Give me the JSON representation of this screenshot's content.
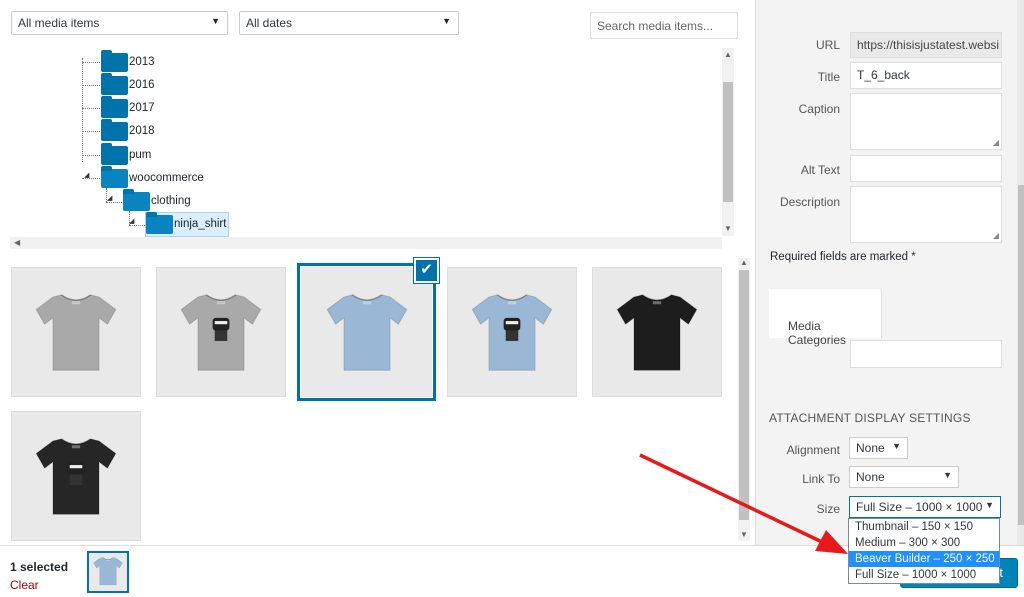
{
  "filters": {
    "media_type": "All media items",
    "dates": "All dates",
    "search_placeholder": "Search media items..."
  },
  "tree": {
    "folders": [
      "2013",
      "2016",
      "2017",
      "2018",
      "pum",
      "woocommerce",
      "clothing",
      "ninja_shirt"
    ]
  },
  "thumbnails": [
    {
      "name": "t-shirt-gray-back",
      "color": "#a9a9a9"
    },
    {
      "name": "t-shirt-gray-ninja",
      "color": "#a9a9a9"
    },
    {
      "name": "t-shirt-blue-back",
      "color": "#9ab8d6",
      "selected": true
    },
    {
      "name": "t-shirt-blue-ninja",
      "color": "#9ab8d6"
    },
    {
      "name": "t-shirt-black-back",
      "color": "#1d1d1d"
    },
    {
      "name": "t-shirt-black-ninja",
      "color": "#262626"
    }
  ],
  "details": {
    "url_label": "URL",
    "url_value": "https://thisisjustatest.websi",
    "title_label": "Title",
    "title_value": "T_6_back",
    "caption_label": "Caption",
    "alt_label": "Alt Text",
    "description_label": "Description",
    "required_note": "Required fields are marked *",
    "media_categories_label": "Media Categories"
  },
  "display_settings": {
    "heading": "ATTACHMENT DISPLAY SETTINGS",
    "alignment_label": "Alignment",
    "alignment_value": "None",
    "link_label": "Link To",
    "link_value": "None",
    "size_label": "Size",
    "size_value": "Full Size – 1000 × 1000",
    "size_options": [
      "Thumbnail – 150 × 150",
      "Medium – 300 × 300",
      "Beaver Builder – 250 × 250",
      "Full Size – 1000 × 1000"
    ],
    "highlighted_option": 2
  },
  "toolbar": {
    "selected_count": "1 selected",
    "clear_label": "Clear",
    "insert_label": "t"
  },
  "colors": {
    "accent": "#0073aa",
    "highlight": "#1e90ff",
    "annotation": "#e8191a"
  },
  "icons": {
    "check": "✔",
    "arrow_down": "▼"
  }
}
